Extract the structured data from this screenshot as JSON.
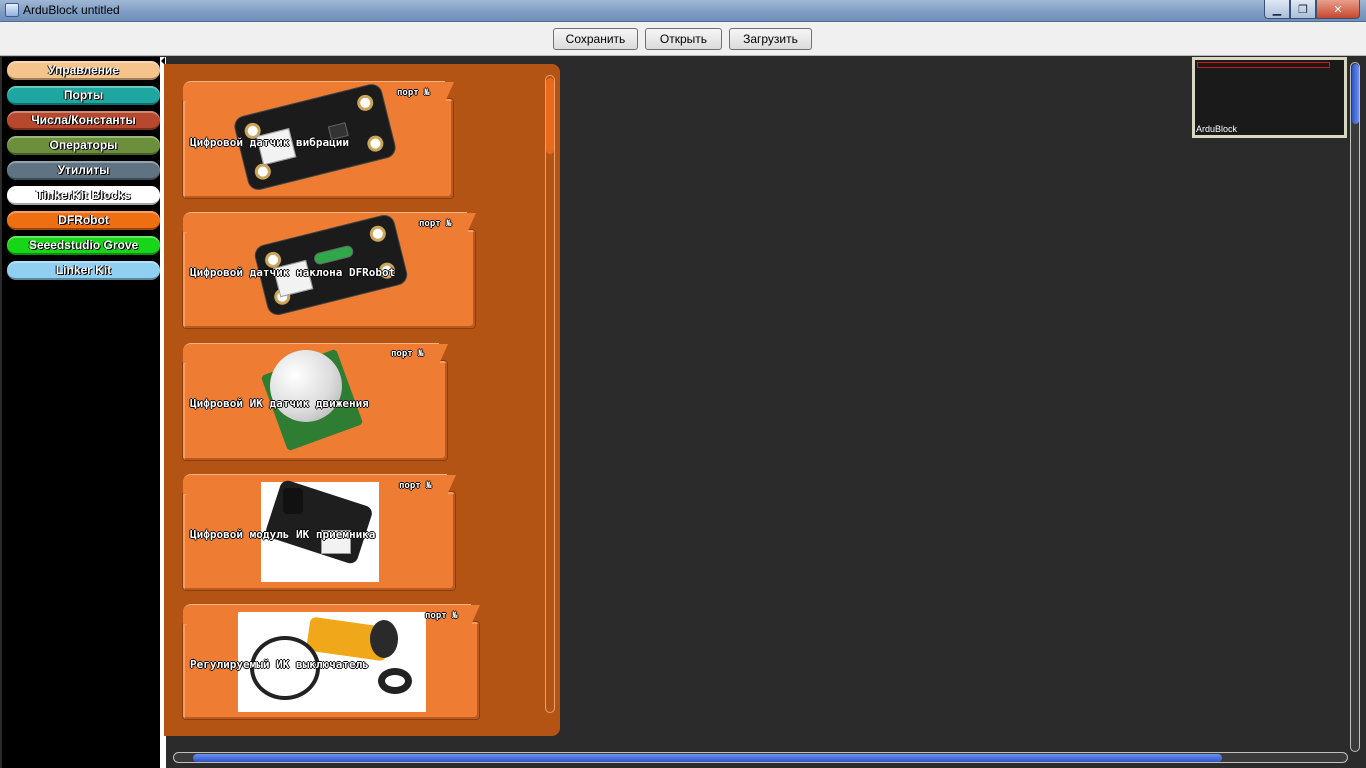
{
  "window": {
    "title": "ArduBlock untitled",
    "minimize": "▁",
    "maximize": "❐",
    "close": "✕"
  },
  "toolbar": {
    "save": "Сохранить",
    "open": "Открыть",
    "upload": "Загрузить"
  },
  "categories": [
    {
      "label": "Управление",
      "color": "#f4c48a"
    },
    {
      "label": "Порты",
      "color": "#1ea7a0"
    },
    {
      "label": "Числа/Константы",
      "color": "#b5482d"
    },
    {
      "label": "Операторы",
      "color": "#6b8f3a"
    },
    {
      "label": "Утилиты",
      "color": "#5f7382"
    },
    {
      "label": "TinkerKit Blocks",
      "color": "#ffffff"
    },
    {
      "label": "DFRobot",
      "color": "#ee6e12"
    },
    {
      "label": "Seeedstudio Grove",
      "color": "#17d617"
    },
    {
      "label": "Linker Kit",
      "color": "#8fcff2"
    }
  ],
  "blocks": [
    {
      "label": "Цифровой датчик вибрации",
      "port": "порт  №"
    },
    {
      "label": "Цифровой датчик наклона DFRobot",
      "port": "порт  №"
    },
    {
      "label": "Цифровой ИК датчик движения",
      "port": "порт  №"
    },
    {
      "label": "Цифровой модуль ИК приемника",
      "port": "порт  №"
    },
    {
      "label": "Регулируемый ИК выключатель",
      "port": "порт  №"
    }
  ],
  "minimap": {
    "label": "ArduBlock"
  }
}
